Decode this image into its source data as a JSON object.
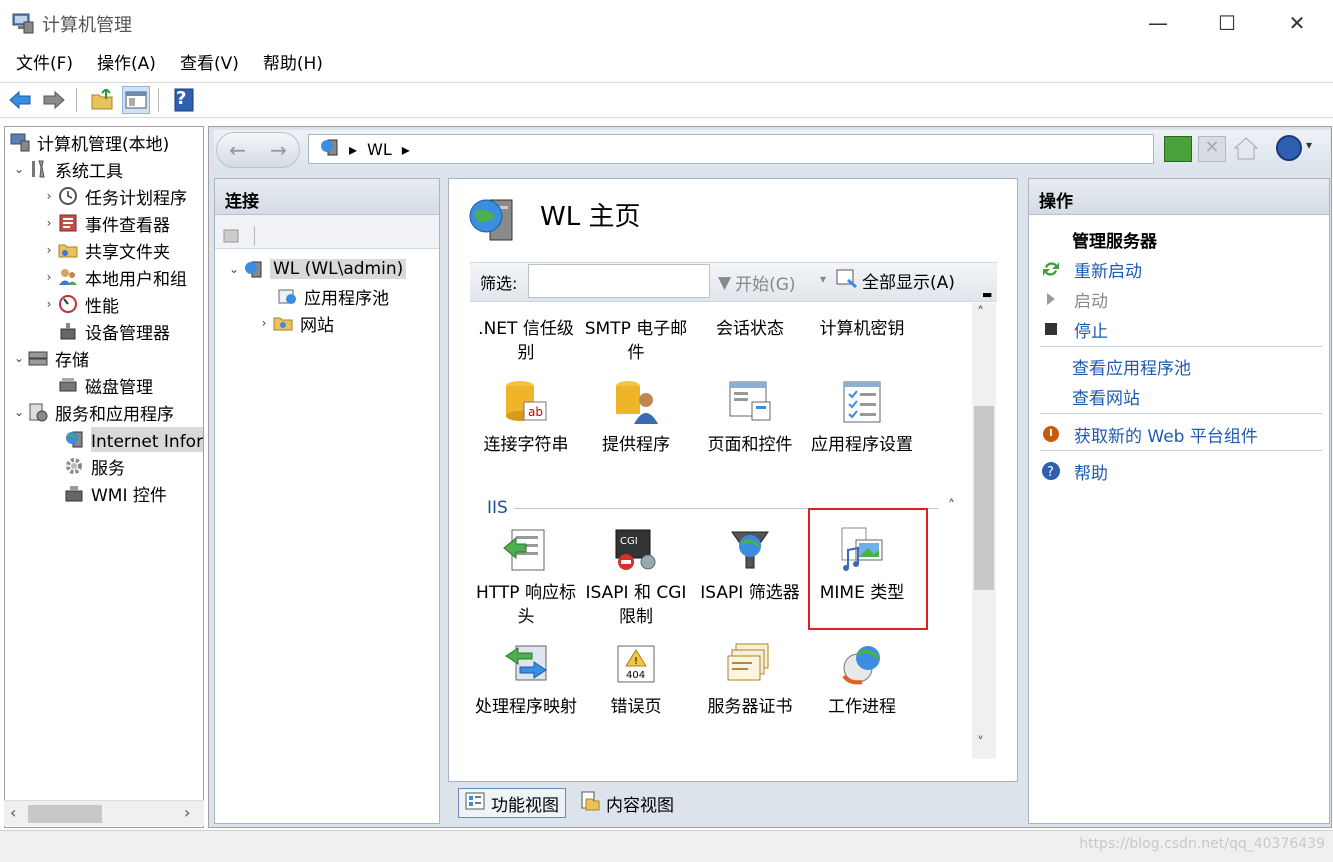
{
  "window": {
    "title": "计算机管理",
    "minimize_glyph": "—",
    "maximize_glyph": "☐",
    "close_glyph": "✕"
  },
  "menu": [
    "文件(F)",
    "操作(A)",
    "查看(V)",
    "帮助(H)"
  ],
  "toolbar": {
    "help_glyph": "?"
  },
  "tree": {
    "root": "计算机管理(本地)",
    "system_tools": "系统工具",
    "task_scheduler": "任务计划程序",
    "event_viewer": "事件查看器",
    "shared_folders": "共享文件夹",
    "local_users": "本地用户和组",
    "performance": "性能",
    "device_manager": "设备管理器",
    "storage": "存储",
    "disk_management": "磁盘管理",
    "services_apps": "服务和应用程序",
    "iis": "Internet Information Services (IIS) 管理器",
    "services": "服务",
    "wmi": "WMI 控件"
  },
  "address": {
    "breadcrumb": [
      "WL"
    ]
  },
  "connections": {
    "title": "连接",
    "server": "WL (WL\\admin)",
    "app_pools": "应用程序池",
    "sites": "网站"
  },
  "center": {
    "title": "WL 主页",
    "filter_label": "筛选:",
    "filter_value": "",
    "start_label": "开始(G)",
    "show_all_label": "全部显示(A)",
    "group_iis": "IIS",
    "features_row1": [
      ".NET 信任级别",
      "SMTP 电子邮件",
      "会话状态",
      "计算机密钥"
    ],
    "features_row2": [
      "连接字符串",
      "提供程序",
      "页面和控件",
      "应用程序设置"
    ],
    "features_row3": [
      "HTTP 响应标头",
      "ISAPI 和 CGI 限制",
      "ISAPI 筛选器",
      "MIME 类型"
    ],
    "features_row4": [
      "处理程序映射",
      "错误页",
      "服务器证书",
      "工作进程"
    ]
  },
  "view_tabs": {
    "feature_view": "功能视图",
    "content_view": "内容视图"
  },
  "actions": {
    "title": "操作",
    "manage_server": "管理服务器",
    "restart": "重新启动",
    "start": "启动",
    "stop": "停止",
    "view_app_pools": "查看应用程序池",
    "view_sites": "查看网站",
    "get_web_components": "获取新的 Web 平台组件",
    "help": "帮助"
  },
  "status": {
    "watermark": "https://blog.csdn.net/qq_40376439"
  },
  "colors": {
    "link": "#1c5bb0",
    "highlight_border": "#e02020",
    "group_header": "#1f4e9a"
  }
}
